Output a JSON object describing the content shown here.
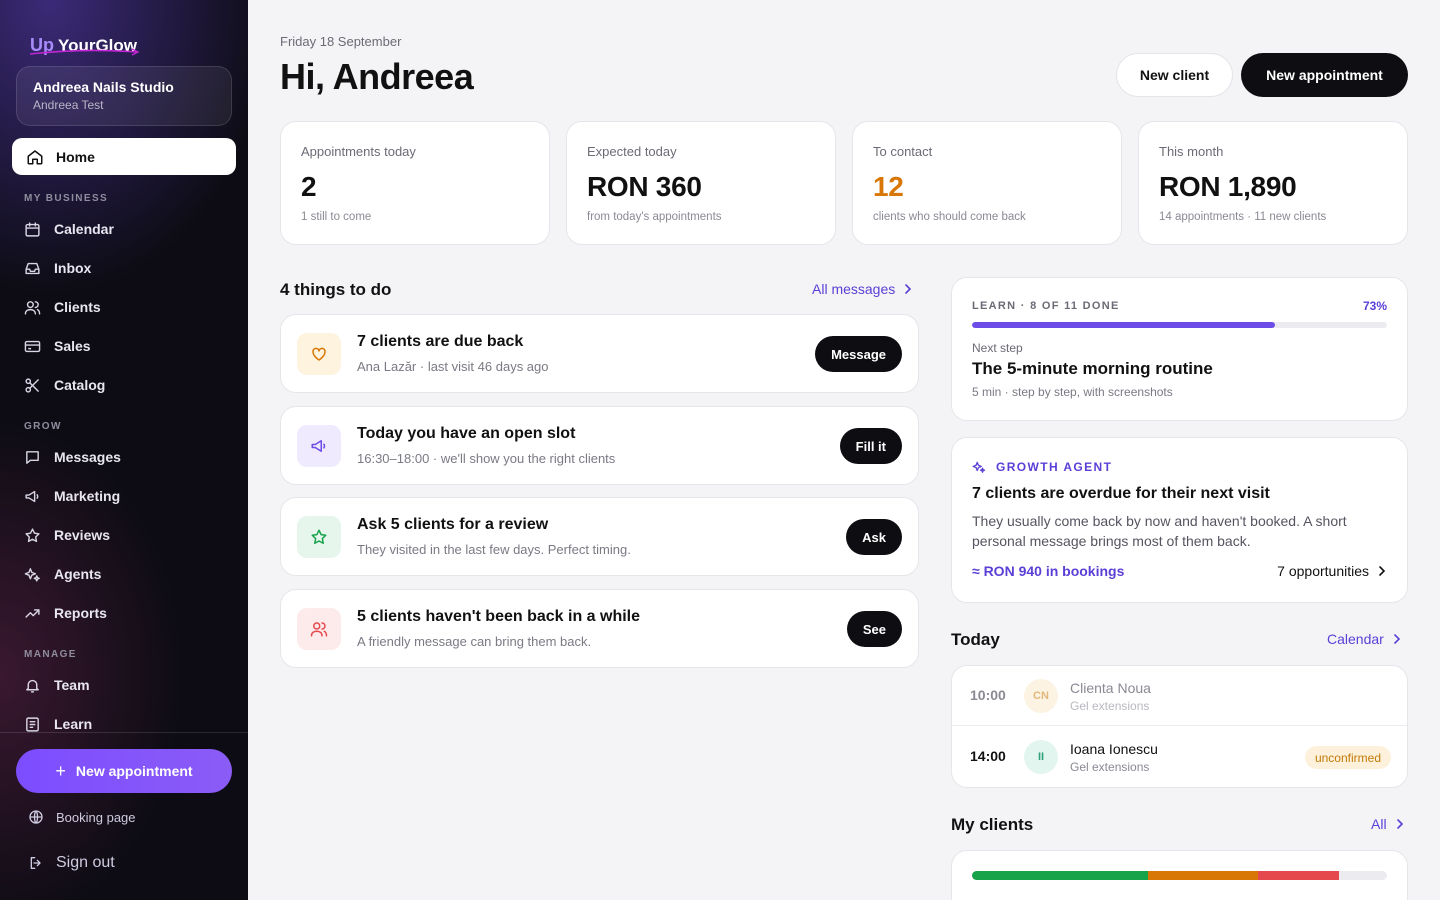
{
  "brand": {
    "logo_prefix": "Up",
    "logo_name": "YourGlow"
  },
  "studio": {
    "name": "Andreea Nails Studio",
    "user": "Andreea Test"
  },
  "sidebar": {
    "home": "Home",
    "sections": {
      "my_business": "MY BUSINESS",
      "grow": "GROW",
      "manage": "MANAGE"
    },
    "items": {
      "calendar": "Calendar",
      "inbox": "Inbox",
      "clients": "Clients",
      "sales": "Sales",
      "catalog": "Catalog",
      "messages": "Messages",
      "marketing": "Marketing",
      "reviews": "Reviews",
      "agents": "Agents",
      "reports": "Reports",
      "team": "Team",
      "learn": "Learn"
    },
    "new_appointment": "New appointment",
    "booking_page": "Booking page",
    "sign_out": "Sign out"
  },
  "header": {
    "date": "Friday 18 September",
    "greeting": "Hi, Andreea",
    "new_client": "New client",
    "new_appointment": "New appointment"
  },
  "stats": [
    {
      "label": "Appointments today",
      "value": "2",
      "sub": "1 still to come"
    },
    {
      "label": "Expected today",
      "value": "RON 360",
      "sub": "from today's appointments"
    },
    {
      "label": "To contact",
      "value": "12",
      "sub": "clients who should come back"
    },
    {
      "label": "This month",
      "value": "RON 1,890",
      "sub": "14 appointments · 11 new clients"
    }
  ],
  "todo": {
    "title": "4 things to do",
    "all_messages": "All messages",
    "tasks": [
      {
        "title": "7 clients are due back",
        "sub": "Ana Lazăr · last visit 46 days ago",
        "action": "Message"
      },
      {
        "title": "Today you have an open slot",
        "sub": "16:30–18:00 · we'll show you the right clients",
        "action": "Fill it"
      },
      {
        "title": "Ask 5 clients for a review",
        "sub": "They visited in the last few days. Perfect timing.",
        "action": "Ask"
      },
      {
        "title": "5 clients haven't been back in a while",
        "sub": "A friendly message can bring them back.",
        "action": "See"
      }
    ]
  },
  "learn": {
    "header": "LEARN · 8 OF 11 DONE",
    "percent_label": "73%",
    "progress": 0.73,
    "next_step_label": "Next step",
    "title": "The 5-minute morning routine",
    "sub": "5 min · step by step, with screenshots"
  },
  "agent": {
    "header": "GROWTH AGENT",
    "title": "7 clients are overdue for their next visit",
    "description": "They usually come back by now and haven't booked. A short personal message brings most of them back.",
    "estimate": "≈ RON 940 in bookings",
    "opportunities": "7 opportunities"
  },
  "today": {
    "title": "Today",
    "calendar_link": "Calendar",
    "appointments": [
      {
        "time": "10:00",
        "initials": "CN",
        "name": "Clienta Noua",
        "service": "Gel extensions",
        "badge": ""
      },
      {
        "time": "14:00",
        "initials": "II",
        "name": "Ioana Ionescu",
        "service": "Gel extensions",
        "badge": "unconfirmed"
      }
    ]
  },
  "my_clients": {
    "title": "My clients",
    "all_link": "All",
    "segments": [
      {
        "share": 0.425,
        "color": "#16a34a"
      },
      {
        "share": 0.265,
        "color": "#d97706"
      },
      {
        "share": 0.195,
        "color": "#e5484d"
      }
    ]
  },
  "colors": {
    "accent": "#6d4ce8",
    "link": "#5b3fd6",
    "warning": "#d97706",
    "dark": "#0d0d12"
  }
}
